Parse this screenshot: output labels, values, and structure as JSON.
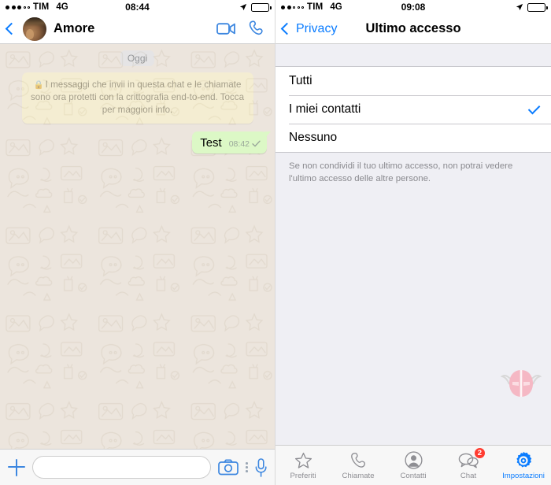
{
  "left": {
    "status": {
      "carrier": "TIM",
      "network": "4G",
      "time": "08:44",
      "signal_filled": 3,
      "signal_empty": 2
    },
    "nav": {
      "back_icon": "chevron-left-icon",
      "contact_name": "Amore",
      "video_label": "video-call-icon",
      "call_label": "voice-call-icon"
    },
    "chat": {
      "date_divider": "Oggi",
      "encryption_notice": "I messaggi che invii in questa chat e le chiamate sono ora protetti con la crittografia end-to-end. Tocca per maggiori info.",
      "lock_glyph": "🔒",
      "messages": [
        {
          "text": "Test",
          "time": "08:42",
          "status": "sent-check",
          "outgoing": true
        }
      ]
    },
    "input": {
      "placeholder": "",
      "value": "",
      "plus": "plus-icon",
      "camera": "camera-icon",
      "more": "more-dots-icon",
      "mic": "microphone-icon"
    }
  },
  "right": {
    "status": {
      "carrier": "TIM",
      "network": "4G",
      "time": "09:08",
      "signal_filled": 2,
      "signal_empty": 3
    },
    "nav": {
      "back_label": "Privacy",
      "title": "Ultimo accesso"
    },
    "options": [
      {
        "label": "Tutti",
        "selected": false
      },
      {
        "label": "I miei contatti",
        "selected": true
      },
      {
        "label": "Nessuno",
        "selected": false
      }
    ],
    "footnote": "Se non condividi il tuo ultimo accesso, non potrai vedere l'ultimo accesso delle altre persone.",
    "tabs": [
      {
        "label": "Preferiti",
        "icon": "star-icon",
        "active": false,
        "badge": ""
      },
      {
        "label": "Chiamate",
        "icon": "phone-icon",
        "active": false,
        "badge": ""
      },
      {
        "label": "Contatti",
        "icon": "contacts-icon",
        "active": false,
        "badge": ""
      },
      {
        "label": "Chat",
        "icon": "chat-bubbles-icon",
        "active": false,
        "badge": "2"
      },
      {
        "label": "Impostazioni",
        "icon": "gear-icon",
        "active": true,
        "badge": ""
      }
    ]
  },
  "colors": {
    "accent_blue": "#0a7cff",
    "chat_bg": "#ece5dd",
    "out_bubble": "#dcf8c6",
    "encryption_bubble": "#fdf6c8",
    "badge_red": "#ff3b30",
    "settings_bg": "#efeff4"
  }
}
